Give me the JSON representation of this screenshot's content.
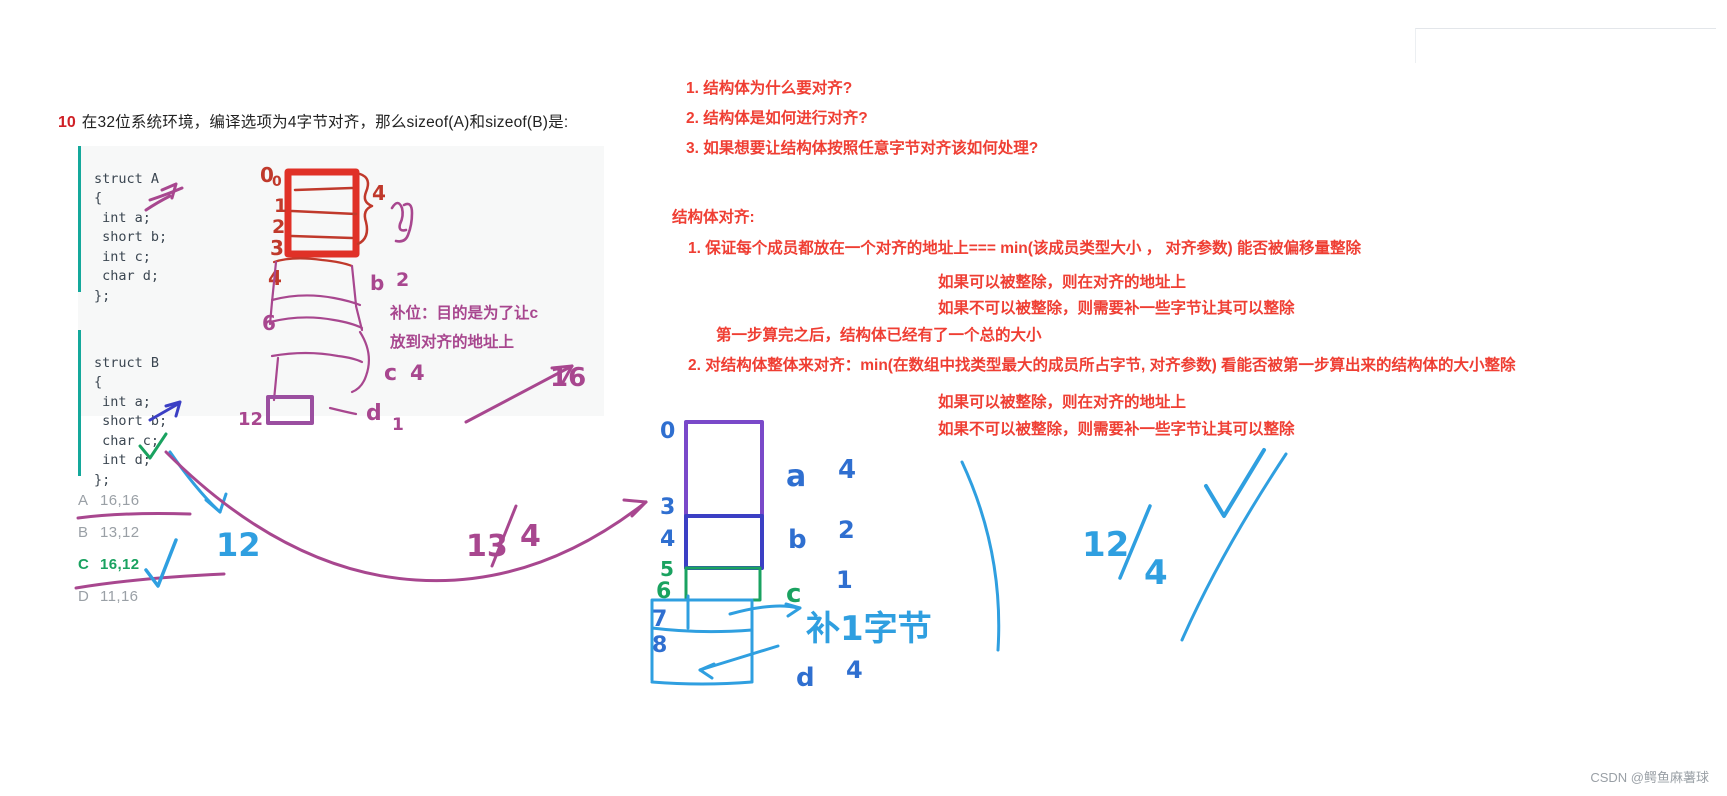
{
  "question": {
    "number": "10",
    "text": "在32位系统环境，编译选项为4字节对齐，那么sizeof(A)和sizeof(B)是:"
  },
  "code_blocks": [
    {
      "name": "struct-a",
      "lines": [
        "struct A",
        "{",
        " int a;",
        " short b;",
        " int c;",
        " char d;",
        "};"
      ]
    },
    {
      "name": "struct-b",
      "lines": [
        "struct B",
        "{",
        " int a;",
        " short b;",
        " char c;",
        " int d;",
        "};"
      ]
    }
  ],
  "options": [
    {
      "key": "A",
      "value": "16,16",
      "correct": false
    },
    {
      "key": "B",
      "value": "13,12",
      "correct": false
    },
    {
      "key": "C",
      "value": "16,12",
      "correct": true
    },
    {
      "key": "D",
      "value": "11,16",
      "correct": false
    }
  ],
  "notes": {
    "questions": [
      "1. 结构体为什么要对齐?",
      "2. 结构体是如何进行对齐?",
      "3. 如果想要让结构体按照任意字节对齐该如何处理?"
    ],
    "heading": "结构体对齐:",
    "rules": [
      "1. 保证每个成员都放在一个对齐的地址上=== min(该成员类型大小 ， 对齐参数) 能否被偏移量整除",
      "如果可以被整除，则在对齐的地址上",
      "如果不可以被整除，则需要补一些字节让其可以整除",
      "第一步算完之后，结构体已经有了一个总的大小",
      "2. 对结构体整体来对齐：min(在数组中找类型最大的成员所占字节, 对齐参数) 看能否被第一步算出来的结构体的大小整除",
      "如果可以被整除，则在对齐的地址上",
      "如果不可以被整除，则需要补一些字节让其可以整除"
    ],
    "purple_note": [
      "补位：目的是为了让c",
      "放到对齐的地址上"
    ]
  },
  "annotations": {
    "struct_a": {
      "offsets": [
        "0",
        "1",
        "2",
        "3",
        "4",
        "6",
        "12"
      ],
      "sizes": [
        {
          "member": "a",
          "bytes": "4"
        },
        {
          "member": "b",
          "bytes": "2"
        },
        {
          "member": "c",
          "bytes": "4"
        },
        {
          "member": "d",
          "bytes": "1"
        }
      ],
      "total": "16",
      "work": "13 / 4"
    },
    "struct_b": {
      "offsets": [
        "0",
        "3",
        "4",
        "5",
        "6",
        "7",
        "8"
      ],
      "sizes": [
        {
          "member": "a",
          "bytes": "4"
        },
        {
          "member": "b",
          "bytes": "2"
        },
        {
          "member": "c",
          "bytes": "1"
        },
        {
          "member": "d",
          "bytes": "4"
        }
      ],
      "label": "补1字节",
      "work": "12 / 4",
      "total": "12"
    }
  },
  "watermark": "CSDN @鳄鱼麻薯球",
  "colors": {
    "red": "#ef3e33",
    "green": "#1aa260",
    "purple": "#a8478f",
    "blue": "#2f6fd0",
    "dark_blue": "#3b3fc4",
    "code_accent": "#14a89b",
    "crimson": "#cf2026"
  }
}
